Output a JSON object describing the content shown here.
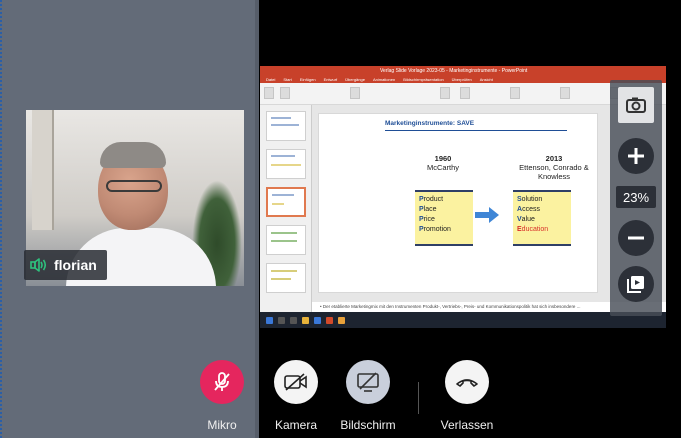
{
  "participant": {
    "name": "florian",
    "audio_icon": "speaker-active-icon",
    "audio_color": "#2ec27e"
  },
  "shared_screen": {
    "app_title": "Verlag Slide Vorlage 2023-05 - Marketinginstrumente - PowerPoint",
    "menu": [
      "Datei",
      "Start",
      "Einfügen",
      "Entwurf",
      "Übergänge",
      "Animationen",
      "Bildschirmpräsentation",
      "Überprüfen",
      "Ansicht"
    ],
    "slide": {
      "title": "Marketinginstrumente: SAVE",
      "left_year": "1960",
      "left_author": "McCarthy",
      "right_year": "2013",
      "right_author_1": "Ettenson, Conrado &",
      "right_author_2": "Knowless",
      "left_items": [
        {
          "initial": "P",
          "rest": "roduct"
        },
        {
          "initial": "P",
          "rest": "lace"
        },
        {
          "initial": "P",
          "rest": "rice"
        },
        {
          "initial": "P",
          "rest": "romotion"
        }
      ],
      "right_items": [
        {
          "initial": "S",
          "rest": "olution"
        },
        {
          "initial": "A",
          "rest": "ccess"
        },
        {
          "initial": "V",
          "rest": "alue"
        },
        {
          "initial": "E",
          "rest": "ducation"
        }
      ]
    },
    "notes_text": "• Der etablierte Marketingmix mit den Instrumenten Produkt-, Vertriebs-, Preis- und Kommunikationspolitik hat sich insbesondere ..."
  },
  "zoom": {
    "value": "23%",
    "snapshot_icon": "camera-icon",
    "zoom_in_icon": "plus-icon",
    "zoom_out_icon": "minus-icon",
    "gallery_icon": "gallery-icon"
  },
  "controls": {
    "mic_label": "Mikro",
    "camera_label": "Kamera",
    "screen_label": "Bildschirm",
    "leave_label": "Verlassen",
    "mic_color": "#e5265e",
    "camera_color": "#f4f4f4",
    "screen_color": "#c9cfdb",
    "leave_color": "#f4f4f4"
  }
}
